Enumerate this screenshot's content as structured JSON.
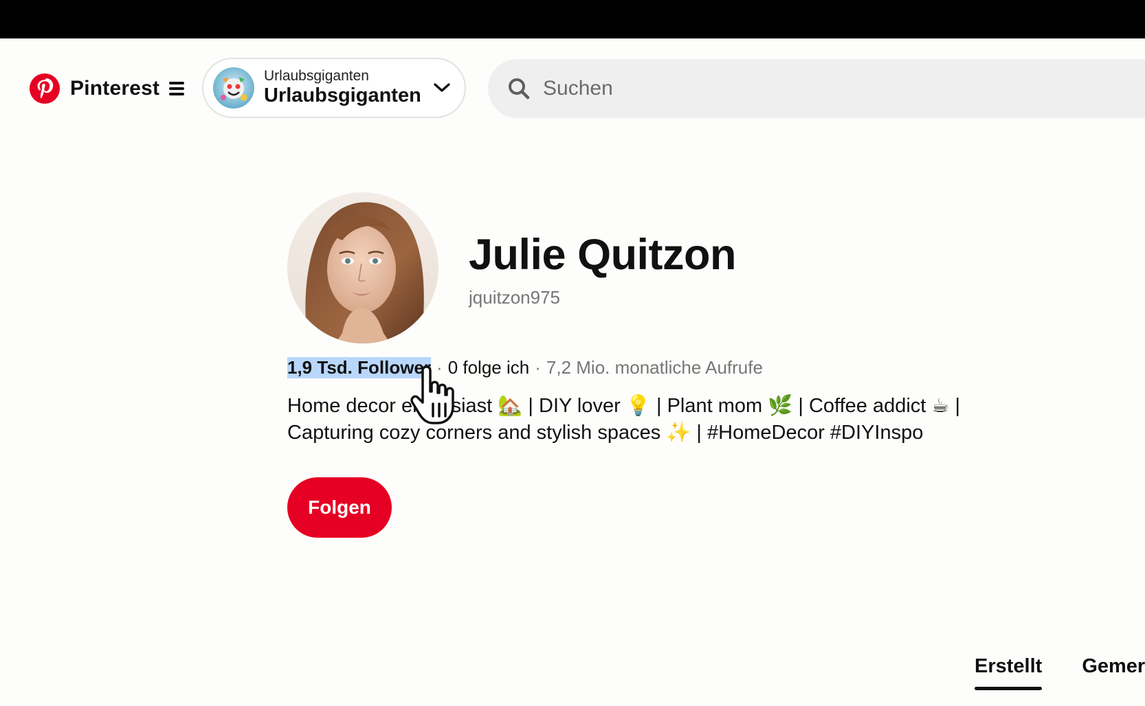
{
  "colors": {
    "brand_red": "#e60023",
    "text_primary": "#111111",
    "text_secondary": "#767676",
    "search_bg": "#efefef",
    "selection_highlight": "#b9d7fb"
  },
  "header": {
    "brand_name": "Pinterest",
    "brand_icon": "pinterest-logo-icon",
    "menu_icon": "menu-icon",
    "account": {
      "subtitle": "Urlaubsgiganten",
      "name": "Urlaubsgiganten",
      "chevron_icon": "chevron-down-icon"
    },
    "search": {
      "icon": "search-icon",
      "placeholder": "Suchen",
      "value": ""
    }
  },
  "profile": {
    "name": "Julie Quitzon",
    "handle": "jquitzon975",
    "stats": {
      "followers": "1,9 Tsd. Follower",
      "separator": "·",
      "following": "0 folge ich",
      "views": "7,2 Mio. monatliche Aufrufe"
    },
    "bio": {
      "line1": "Home decor enthusiast 🏡 | DIY lover 💡 | Plant mom 🌿 | Coffee addict ☕ |",
      "line2": "Capturing cozy corners and stylish spaces ✨ | #HomeDecor #DIYInspo"
    },
    "follow_label": "Folgen"
  },
  "tabs": [
    {
      "label": "Erstellt",
      "active": true
    },
    {
      "label": "Gemerkt",
      "active": false
    }
  ]
}
